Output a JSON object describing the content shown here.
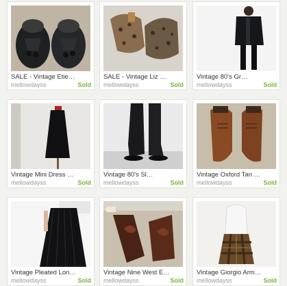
{
  "listings": [
    {
      "title": "SALE - Vintage Etie…",
      "shop": "mellowdayss",
      "status": "Sold",
      "image": "black-woven-loafers"
    },
    {
      "title": "SALE - Vintage Liz …",
      "shop": "mellowdayss",
      "status": "Sold",
      "image": "leopard-print-booties"
    },
    {
      "title": "Vintage 80's Gr…",
      "shop": "mellowdayss",
      "status": "Sold",
      "image": "black-blazer-outfit"
    },
    {
      "title": "Vintage Mini Dress …",
      "shop": "mellowdayss",
      "status": "Sold",
      "image": "black-mini-dress"
    },
    {
      "title": "Vintage 80's Sl…",
      "shop": "mellowdayss",
      "status": "Sold",
      "image": "black-slouch-boots"
    },
    {
      "title": "Vintage Oxford Tan …",
      "shop": "mellowdayss",
      "status": "Sold",
      "image": "tan-oxford-shoes"
    },
    {
      "title": "Vintage Pleated Lon…",
      "shop": "mellowdayss",
      "status": "Sold",
      "image": "black-pleated-skirt"
    },
    {
      "title": "Vintage Nine West E…",
      "shop": "mellowdayss",
      "status": "Sold",
      "image": "brown-western-boots"
    },
    {
      "title": "Vintage Giorgio Arm…",
      "shop": "mellowdayss",
      "status": "Sold",
      "image": "plaid-skirt-outfit"
    }
  ],
  "colors": {
    "sold": "#77b53a",
    "shop": "#9a9a9a",
    "title": "#333333"
  }
}
